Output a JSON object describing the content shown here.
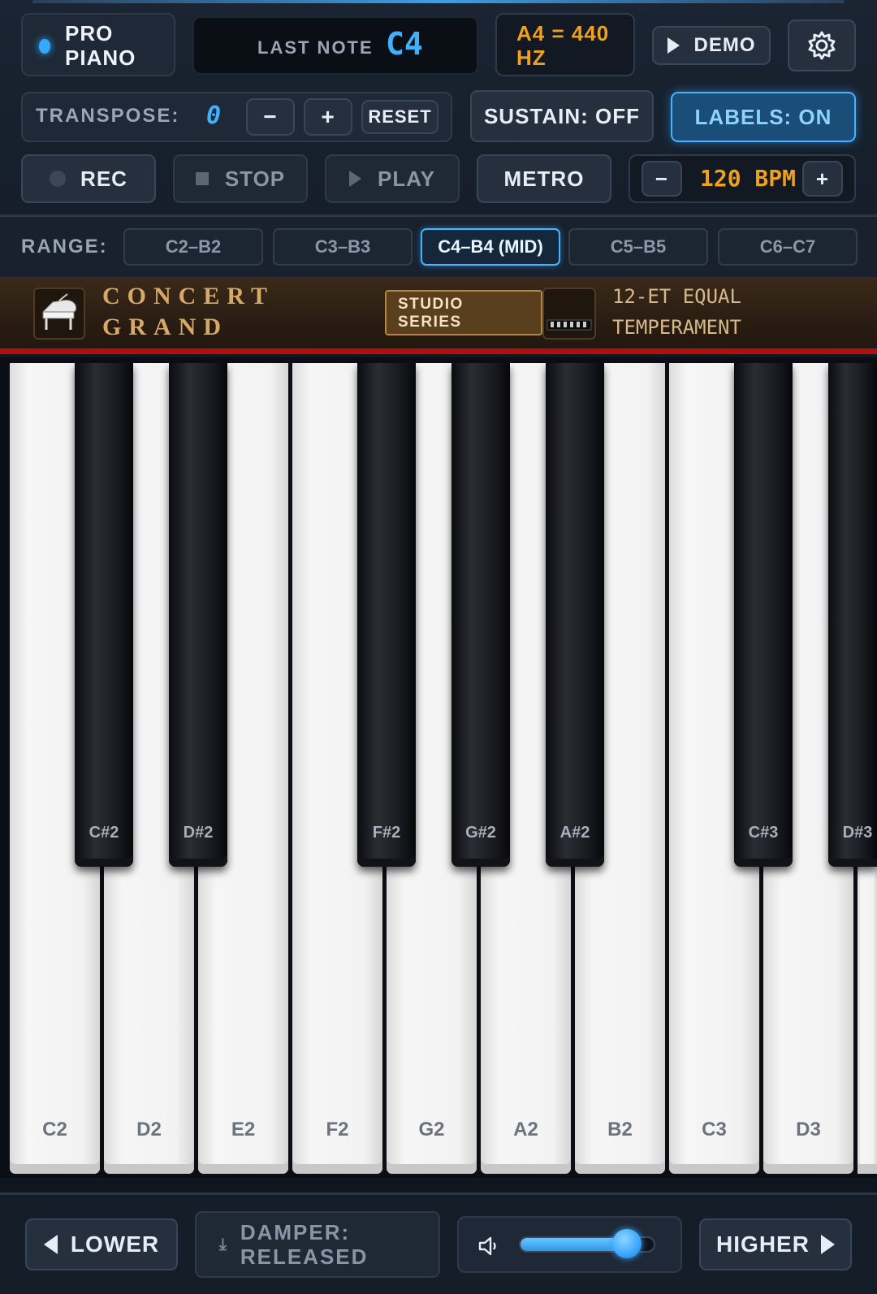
{
  "app": {
    "brand_line1": "PRO",
    "brand_line2": "PIANO"
  },
  "display": {
    "last_note_label": "LAST NOTE",
    "last_note_value": "C4",
    "tuning_line1": "A4 = 440",
    "tuning_line2": "HZ"
  },
  "toolbar": {
    "demo_label": "DEMO",
    "settings_icon": "gear-icon"
  },
  "transpose": {
    "label": "TRANSPOSE:",
    "value": "0",
    "minus": "−",
    "plus": "+",
    "reset": "RESET"
  },
  "toggles": {
    "sustain": "SUSTAIN: OFF",
    "labels": "LABELS: ON"
  },
  "transport": {
    "rec": "REC",
    "stop": "STOP",
    "play": "PLAY",
    "metro": "METRO",
    "bpm_minus": "−",
    "bpm_value": "120 BPM",
    "bpm_plus": "+"
  },
  "range": {
    "label": "RANGE:",
    "options": [
      "C2–B2",
      "C3–B3",
      "C4–B4 (MID)",
      "C5–B5",
      "C6–C7"
    ],
    "selected": "C4–B4 (MID)"
  },
  "instrument": {
    "name_line1": "CONCERT",
    "name_line2": "GRAND",
    "badge_line1": "STUDIO",
    "badge_line2": "SERIES",
    "temperament_line1": "12-ET EQUAL",
    "temperament_line2": "TEMPERAMENT"
  },
  "keys": {
    "white": [
      "C2",
      "D2",
      "E2",
      "F2",
      "G2",
      "A2",
      "B2",
      "C3",
      "D3",
      ""
    ],
    "black": [
      "C#2",
      "D#2",
      "F#2",
      "G#2",
      "A#2",
      "C#3",
      "D#3"
    ]
  },
  "bottom": {
    "lower": "LOWER",
    "damper_line1": "DAMPER:",
    "damper_line2": "RELEASED",
    "higher": "HIGHER",
    "volume": 0.8
  },
  "colors": {
    "accent": "#3fb2ff",
    "amber": "#f0a020",
    "wood": "#2a1d12",
    "red_strip": "#b30f0f"
  }
}
